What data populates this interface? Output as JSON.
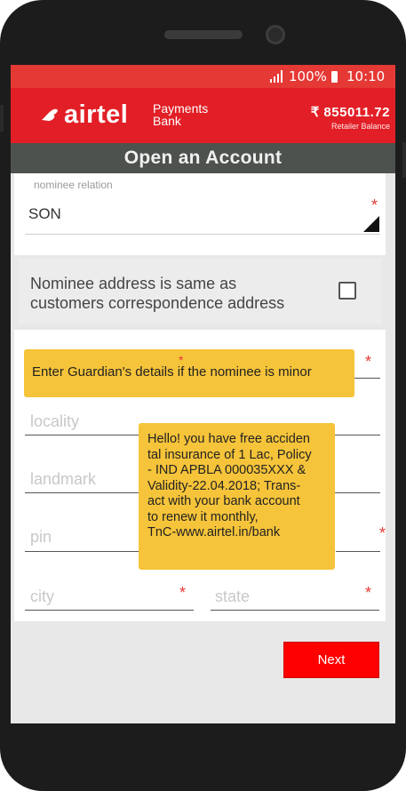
{
  "status_bar": {
    "battery": "100%",
    "time": "10:10"
  },
  "header": {
    "brand": "airtel",
    "sub_brand_line1": "Payments",
    "sub_brand_line2": "Bank",
    "balance": "₹ 855011.72",
    "balance_label": "Retailer Balance"
  },
  "page": {
    "title": "Open an Account"
  },
  "nominee": {
    "relation_label": "nominee relation",
    "relation_value": "SON",
    "required_mark": "*"
  },
  "address_same": {
    "label_line1": "Nominee address is same as",
    "label_line2": "customers correspondence address",
    "checked": false
  },
  "address_fields": {
    "locality": "locality",
    "landmark": "landmark",
    "pin": "pin",
    "city": "city",
    "state": "state",
    "required_mark": "*"
  },
  "guardian_tooltip": "Enter Guardian's details if the nominee is  minor",
  "promo": {
    "line1": "Hello! you have free acciden",
    "line2": "tal insurance of 1 Lac, Policy",
    "line3": "- IND APBLA 000035XXX &",
    "line4": "Validity-22.04.2018; Trans-",
    "line5": "act with your bank account",
    "line6": "to renew it monthly,",
    "line7": "TnC-www.airtel.in/bank"
  },
  "actions": {
    "next_label": "Next"
  },
  "colors": {
    "brand_red": "#e21f26",
    "title_bar": "#4d524e",
    "tooltip_yellow": "#f6c43a",
    "next_button": "#ff0000"
  }
}
